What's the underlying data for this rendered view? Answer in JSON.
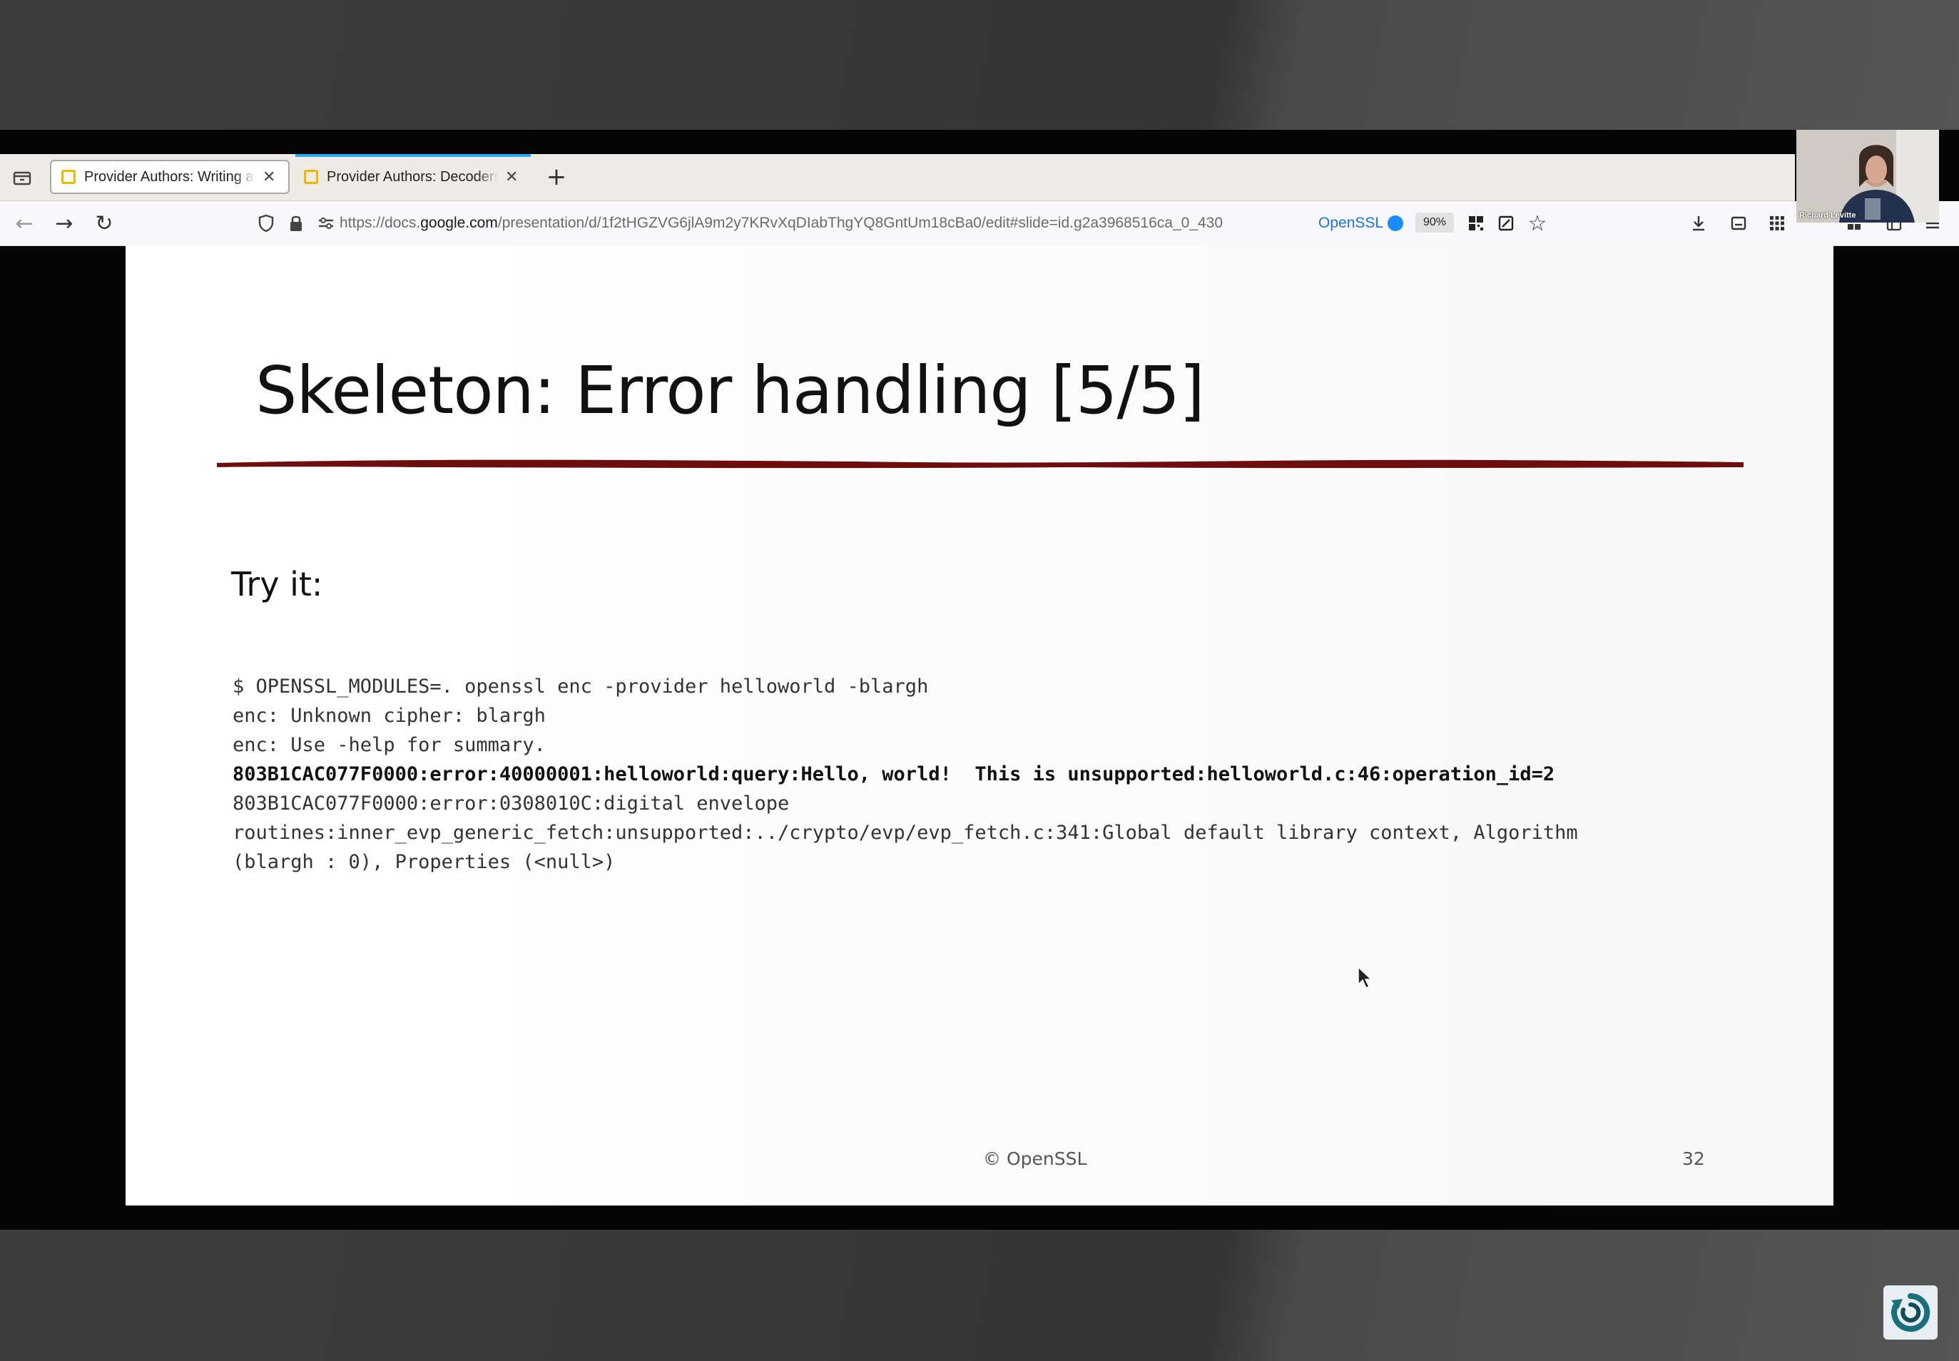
{
  "browser": {
    "tabs": [
      {
        "title": "Provider Authors: Writing a",
        "active": true
      },
      {
        "title": "Provider Authors: Decoders",
        "active": false
      }
    ],
    "new_tab_label": "+",
    "url_prefix": "https://docs.",
    "url_host": "google.com",
    "url_path": "/presentation/d/1f2tHGZVG6jlA9m2y7KRvXqDIabThgYQ8GntUm18cBa0/edit#slide=id.g2a3968516ca_0_430",
    "account_label": "OpenSSL",
    "zoom": "90%"
  },
  "slide": {
    "title": "Skeleton: Error handling [5/5]",
    "subtitle": "Try it:",
    "code_lines": [
      {
        "text": "$ OPENSSL_MODULES=. openssl enc -provider helloworld -blargh",
        "bold": false
      },
      {
        "text": "enc: Unknown cipher: blargh",
        "bold": false
      },
      {
        "text": "enc: Use -help for summary.",
        "bold": false
      },
      {
        "text": "803B1CAC077F0000:error:40000001:helloworld:query:Hello, world!  This is unsupported:helloworld.c:46:operation_id=2",
        "bold": true
      },
      {
        "text": "803B1CAC077F0000:error:0308010C:digital envelope",
        "bold": false
      },
      {
        "text": "routines:inner_evp_generic_fetch:unsupported:../crypto/evp/evp_fetch.c:341:Global default library context, Algorithm",
        "bold": false
      },
      {
        "text": "(blargh : 0), Properties (<null>)",
        "bold": false
      }
    ],
    "footer_copyright": "© OpenSSL",
    "page_number": "32"
  },
  "webcam": {
    "name": "Richard Levitte"
  },
  "colors": {
    "accent_underline": "#6e0d0d",
    "tab_active_line": "#2aa7f5",
    "account_dot": "#1a8cff"
  }
}
